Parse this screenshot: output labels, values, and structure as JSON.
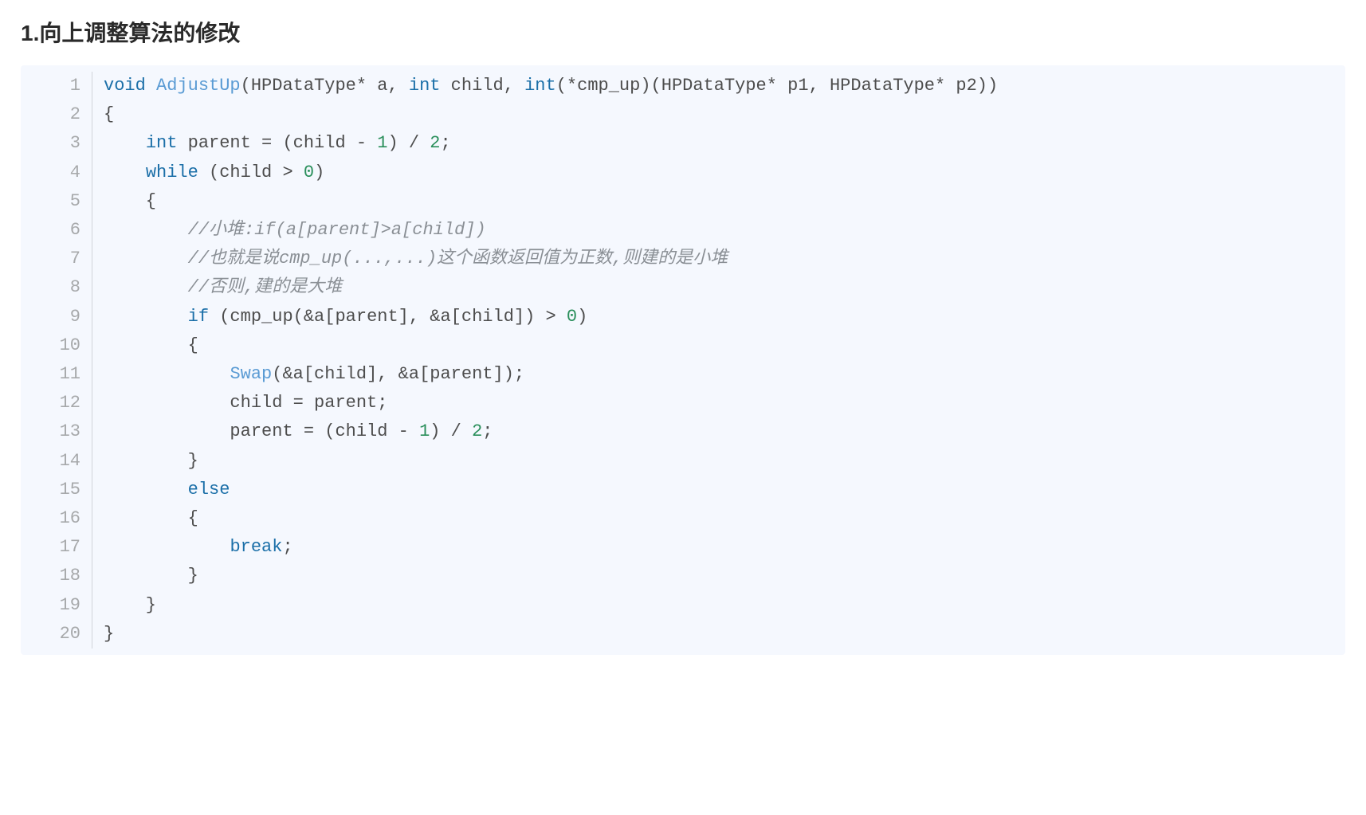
{
  "heading": "1.向上调整算法的修改",
  "code": {
    "lines": [
      {
        "n": "1",
        "tokens": [
          {
            "c": "tok-kw",
            "t": "void"
          },
          {
            "c": "tok-pn",
            "t": " "
          },
          {
            "c": "tok-fn",
            "t": "AdjustUp"
          },
          {
            "c": "tok-pn",
            "t": "(HPDataType* a, "
          },
          {
            "c": "tok-kw",
            "t": "int"
          },
          {
            "c": "tok-pn",
            "t": " child, "
          },
          {
            "c": "tok-kw",
            "t": "int"
          },
          {
            "c": "tok-pn",
            "t": "(*cmp_up)(HPDataType* p1, HPDataType* p2))"
          }
        ]
      },
      {
        "n": "2",
        "tokens": [
          {
            "c": "tok-pn",
            "t": "{"
          }
        ]
      },
      {
        "n": "3",
        "tokens": [
          {
            "c": "tok-pn",
            "t": "    "
          },
          {
            "c": "tok-kw",
            "t": "int"
          },
          {
            "c": "tok-pn",
            "t": " parent = (child - "
          },
          {
            "c": "tok-num",
            "t": "1"
          },
          {
            "c": "tok-pn",
            "t": ") / "
          },
          {
            "c": "tok-num",
            "t": "2"
          },
          {
            "c": "tok-pn",
            "t": ";"
          }
        ]
      },
      {
        "n": "4",
        "tokens": [
          {
            "c": "tok-pn",
            "t": "    "
          },
          {
            "c": "tok-kw",
            "t": "while"
          },
          {
            "c": "tok-pn",
            "t": " (child > "
          },
          {
            "c": "tok-num",
            "t": "0"
          },
          {
            "c": "tok-pn",
            "t": ")"
          }
        ]
      },
      {
        "n": "5",
        "tokens": [
          {
            "c": "tok-pn",
            "t": "    {"
          }
        ]
      },
      {
        "n": "6",
        "tokens": [
          {
            "c": "tok-pn",
            "t": "        "
          },
          {
            "c": "tok-cmt",
            "t": "//小堆:if(a[parent]>a[child])"
          }
        ]
      },
      {
        "n": "7",
        "tokens": [
          {
            "c": "tok-pn",
            "t": "        "
          },
          {
            "c": "tok-cmt",
            "t": "//也就是说cmp_up(...,...)这个函数返回值为正数,则建的是小堆"
          }
        ]
      },
      {
        "n": "8",
        "tokens": [
          {
            "c": "tok-pn",
            "t": "        "
          },
          {
            "c": "tok-cmt",
            "t": "//否则,建的是大堆"
          }
        ]
      },
      {
        "n": "9",
        "tokens": [
          {
            "c": "tok-pn",
            "t": "        "
          },
          {
            "c": "tok-kw",
            "t": "if"
          },
          {
            "c": "tok-pn",
            "t": " (cmp_up(&a[parent], &a[child]) > "
          },
          {
            "c": "tok-num",
            "t": "0"
          },
          {
            "c": "tok-pn",
            "t": ")"
          }
        ]
      },
      {
        "n": "10",
        "tokens": [
          {
            "c": "tok-pn",
            "t": "        {"
          }
        ]
      },
      {
        "n": "11",
        "tokens": [
          {
            "c": "tok-pn",
            "t": "            "
          },
          {
            "c": "tok-fn",
            "t": "Swap"
          },
          {
            "c": "tok-pn",
            "t": "(&a[child], &a[parent]);"
          }
        ]
      },
      {
        "n": "12",
        "tokens": [
          {
            "c": "tok-pn",
            "t": "            child = parent;"
          }
        ]
      },
      {
        "n": "13",
        "tokens": [
          {
            "c": "tok-pn",
            "t": "            parent = (child - "
          },
          {
            "c": "tok-num",
            "t": "1"
          },
          {
            "c": "tok-pn",
            "t": ") / "
          },
          {
            "c": "tok-num",
            "t": "2"
          },
          {
            "c": "tok-pn",
            "t": ";"
          }
        ]
      },
      {
        "n": "14",
        "tokens": [
          {
            "c": "tok-pn",
            "t": "        }"
          }
        ]
      },
      {
        "n": "15",
        "tokens": [
          {
            "c": "tok-pn",
            "t": "        "
          },
          {
            "c": "tok-kw",
            "t": "else"
          }
        ]
      },
      {
        "n": "16",
        "tokens": [
          {
            "c": "tok-pn",
            "t": "        {"
          }
        ]
      },
      {
        "n": "17",
        "tokens": [
          {
            "c": "tok-pn",
            "t": "            "
          },
          {
            "c": "tok-kw",
            "t": "break"
          },
          {
            "c": "tok-pn",
            "t": ";"
          }
        ]
      },
      {
        "n": "18",
        "tokens": [
          {
            "c": "tok-pn",
            "t": "        }"
          }
        ]
      },
      {
        "n": "19",
        "tokens": [
          {
            "c": "tok-pn",
            "t": "    }"
          }
        ]
      },
      {
        "n": "20",
        "tokens": [
          {
            "c": "tok-pn",
            "t": "}"
          }
        ]
      }
    ]
  }
}
